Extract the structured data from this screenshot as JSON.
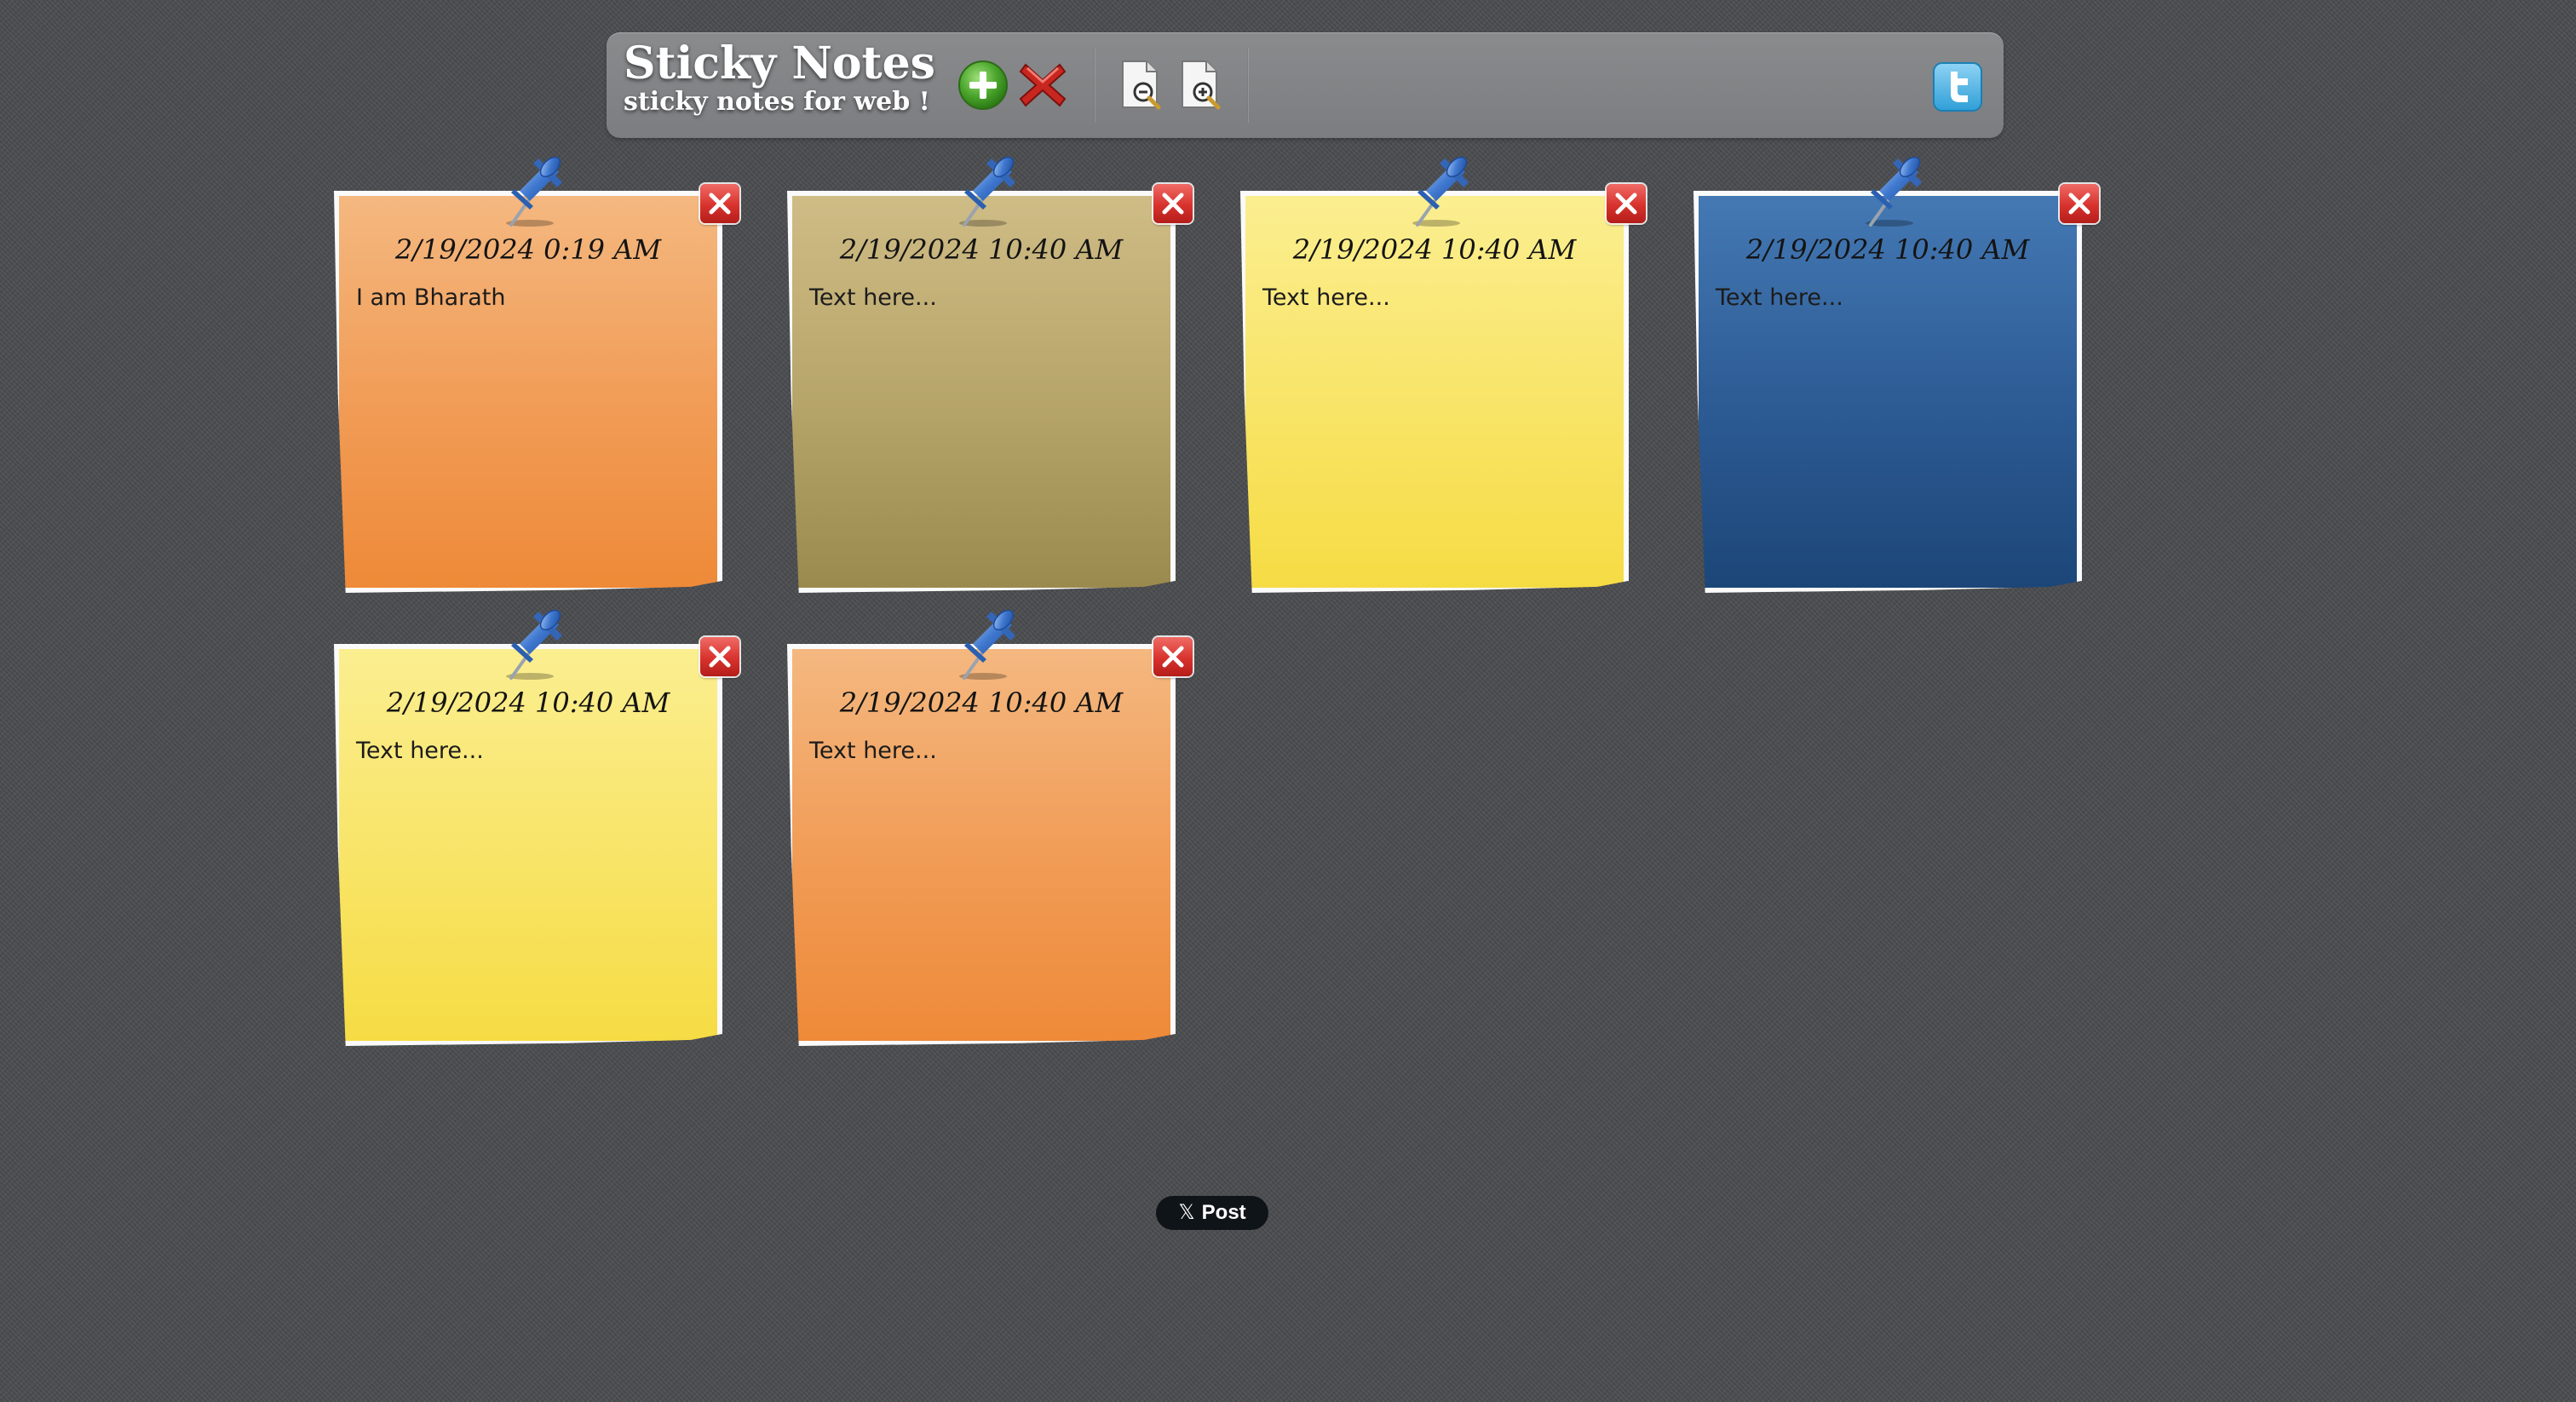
{
  "header": {
    "title": "Sticky Notes",
    "subtitle": "sticky notes for web !",
    "buttons": [
      {
        "name": "add-note",
        "icon": "plus-circle-icon"
      },
      {
        "name": "delete-all",
        "icon": "red-x-icon"
      },
      {
        "name": "zoom-out",
        "icon": "document-zoom-out-icon"
      },
      {
        "name": "zoom-in",
        "icon": "document-zoom-in-icon"
      }
    ],
    "twitter_icon": "twitter-icon"
  },
  "notes": [
    {
      "date": "2/19/2024 0:19 AM",
      "text": "I am Bharath",
      "color": "orange"
    },
    {
      "date": "2/19/2024 10:40 AM",
      "text": "Text here...",
      "color": "olive"
    },
    {
      "date": "2/19/2024 10:40 AM",
      "text": "Text here...",
      "color": "yellow"
    },
    {
      "date": "2/19/2024 10:40 AM",
      "text": "Text here...",
      "color": "blue"
    },
    {
      "date": "2/19/2024 10:40 AM",
      "text": "Text here...",
      "color": "yellow"
    },
    {
      "date": "2/19/2024 10:40 AM",
      "text": "Text here...",
      "color": "orange"
    }
  ],
  "post_button": {
    "label": "Post",
    "icon_glyph": "𝕏"
  },
  "colors": {
    "background": "#4b4c4f",
    "orange": "#f19b55",
    "olive": "#b5a468",
    "yellow": "#f8e466",
    "blue": "#2c5a93",
    "close_red": "#d8322d",
    "pin_blue": "#3f78cf"
  }
}
